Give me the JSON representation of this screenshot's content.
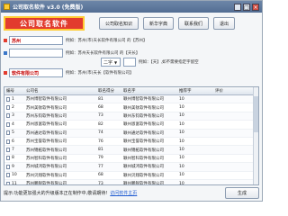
{
  "window": {
    "title": "公司取名软件 v3.0 (免费版)",
    "controls": [
      "_",
      "□",
      "×"
    ]
  },
  "header": {
    "logo_text": "公司取名软件",
    "buttons": [
      "公司取名知识",
      "新华字典",
      "联系我们",
      "退出"
    ]
  },
  "form": {
    "city_value": "苏州",
    "city_hint": "例如：苏州(市)天长软件有限公司 的【苏州】",
    "name_value": "",
    "name_hint": "例如：苏州天长软件有限公司 的【天长】",
    "name_mode": "二字",
    "name_extra_value": "",
    "name_extra_hint": "例如：【天】,如不需要指定字留空",
    "industry_value": "软件有限公司",
    "industry_hint": "例如：苏州(市)天长【软件有限公司】"
  },
  "table": {
    "columns": [
      "编号",
      "公司名",
      "取名得分",
      "取名字",
      "推荐字",
      "评价"
    ],
    "rows": [
      [
        "1",
        "苏州博智软件有限公司",
        "81",
        "颖州博智软件有限公司",
        "10"
      ],
      [
        "2",
        "苏州美钛软件有限公司",
        "68",
        "颖州美钛软件有限公司",
        "10"
      ],
      [
        "3",
        "苏州东钧软件有限公司",
        "73",
        "颖州东钧软件有限公司",
        "10"
      ],
      [
        "4",
        "苏州恩富软件有限公司",
        "82",
        "颖州恩富软件有限公司",
        "10"
      ],
      [
        "5",
        "苏州通达软件有限公司",
        "74",
        "颖州通达软件有限公司",
        "10"
      ],
      [
        "6",
        "苏州宝誉软件有限公司",
        "76",
        "颖州宝誉软件有限公司",
        "10"
      ],
      [
        "7",
        "苏州锦拓软件有限公司",
        "81",
        "颖州锦拓软件有限公司",
        "10"
      ],
      [
        "8",
        "苏州智科软件有限公司",
        "79",
        "颖州智科软件有限公司",
        "10"
      ],
      [
        "9",
        "苏州城鸿软件有限公司",
        "77",
        "颖州城鸿软件有限公司",
        "10"
      ],
      [
        "10",
        "苏州贝翔软件有限公司",
        "68",
        "颖州贝翔软件有限公司",
        "10"
      ],
      [
        "11",
        "苏州鹏锐软件有限公司",
        "73",
        "颖州鹏锐软件有限公司",
        "10"
      ],
      [
        "12",
        "苏州淳鸿软件有限公司",
        "73",
        "颖州淳鸿软件有限公司",
        "10"
      ]
    ]
  },
  "status": {
    "text": "提示:功能更加强大的升级版本正在制作中,敬请期待!",
    "link": "访问软件主页",
    "generate_label": "生成"
  }
}
